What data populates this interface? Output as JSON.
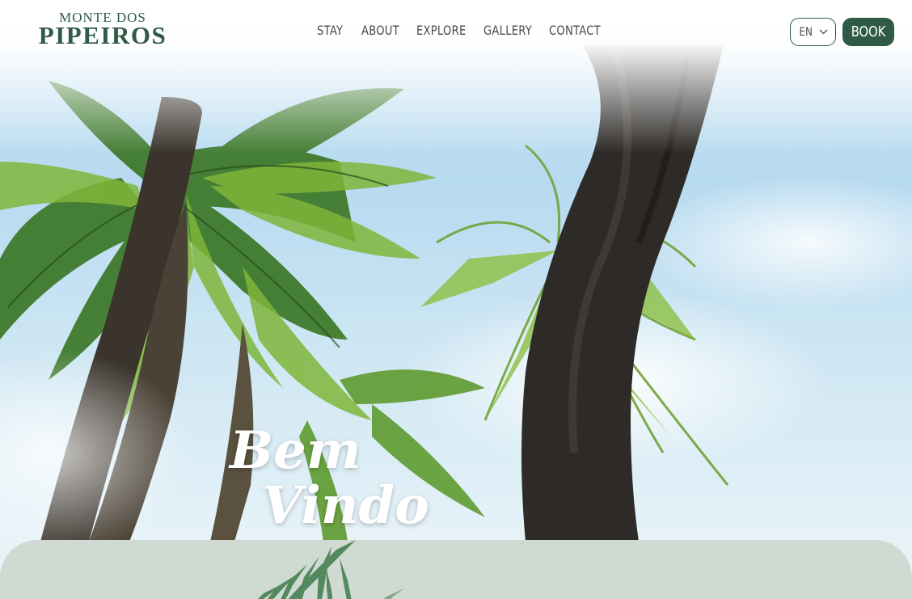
{
  "brand": {
    "line1": "MONTE DOS",
    "line2": "PIPEIROS"
  },
  "nav": {
    "items": [
      {
        "label": "STAY"
      },
      {
        "label": "ABOUT"
      },
      {
        "label": "EXPLORE"
      },
      {
        "label": "GALLERY"
      },
      {
        "label": "CONTACT"
      }
    ]
  },
  "language": {
    "code": "EN",
    "icon": "chevron-down-icon"
  },
  "cta": {
    "label": "BOOK"
  },
  "hero": {
    "line1": "Bem",
    "line2": "Vindo",
    "image": "palm-trees-photo"
  },
  "colors": {
    "brand_green": "#2f5a45",
    "panel_sage": "#cfdbd2",
    "white": "#ffffff"
  }
}
